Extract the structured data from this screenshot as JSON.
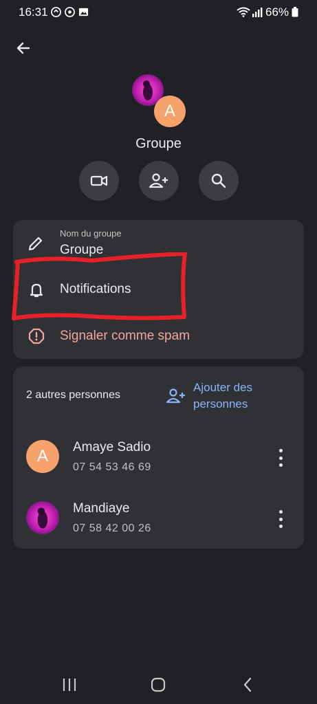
{
  "status_bar": {
    "time": "16:31",
    "battery": "66%"
  },
  "header": {
    "group_name": "Groupe",
    "avatar_letter": "A"
  },
  "actions": {
    "video": "video-icon",
    "add_person": "person-add-icon",
    "search": "search-icon"
  },
  "settings": {
    "group_name_label": "Nom du groupe",
    "group_name_value": "Groupe",
    "notifications": "Notifications",
    "report_spam": "Signaler comme spam"
  },
  "members": {
    "count_label": "2 autres personnes",
    "add_people_line1": "Ajouter des",
    "add_people_line2": "personnes",
    "list": [
      {
        "name": "Amaye Sadio",
        "phone": "07 54 53 46 69",
        "avatar_letter": "A"
      },
      {
        "name": "Mandiaye",
        "phone": "07 58 42 00 26"
      }
    ]
  },
  "colors": {
    "background": "#202124",
    "card": "#303134",
    "accent_link": "#8ab4f8",
    "spam": "#f2a59d",
    "avatar_orange": "#f5a26c",
    "annotation_red": "#e8202a"
  }
}
